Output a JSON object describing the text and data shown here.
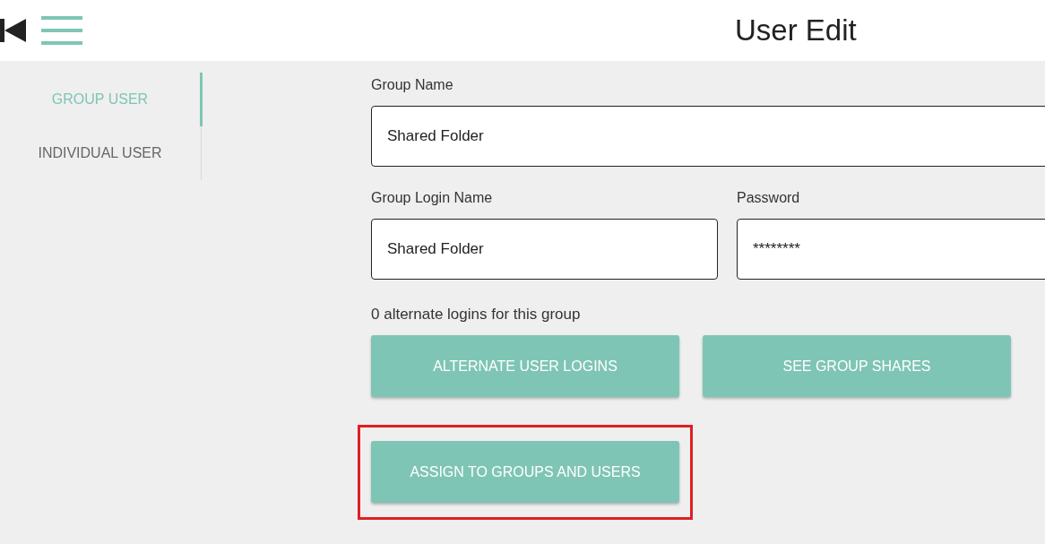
{
  "header": {
    "title": "User Edit"
  },
  "sidebar": {
    "items": [
      {
        "label": "GROUP USER",
        "selected": true
      },
      {
        "label": "INDIVIDUAL USER",
        "selected": false
      }
    ]
  },
  "form": {
    "group_name": {
      "label": "Group Name",
      "value": "Shared Folder"
    },
    "login_name": {
      "label": "Group Login Name",
      "value": "Shared Folder"
    },
    "password": {
      "label": "Password",
      "value": "********"
    },
    "alternate_logins_note": "0 alternate logins for this group",
    "button_rows": [
      [
        {
          "label": "ALTERNATE USER LOGINS",
          "highlighted": false
        },
        {
          "label": "SEE GROUP SHARES",
          "highlighted": false
        }
      ],
      [
        {
          "label": "ASSIGN TO GROUPS AND USERS",
          "highlighted": true
        }
      ]
    ]
  }
}
